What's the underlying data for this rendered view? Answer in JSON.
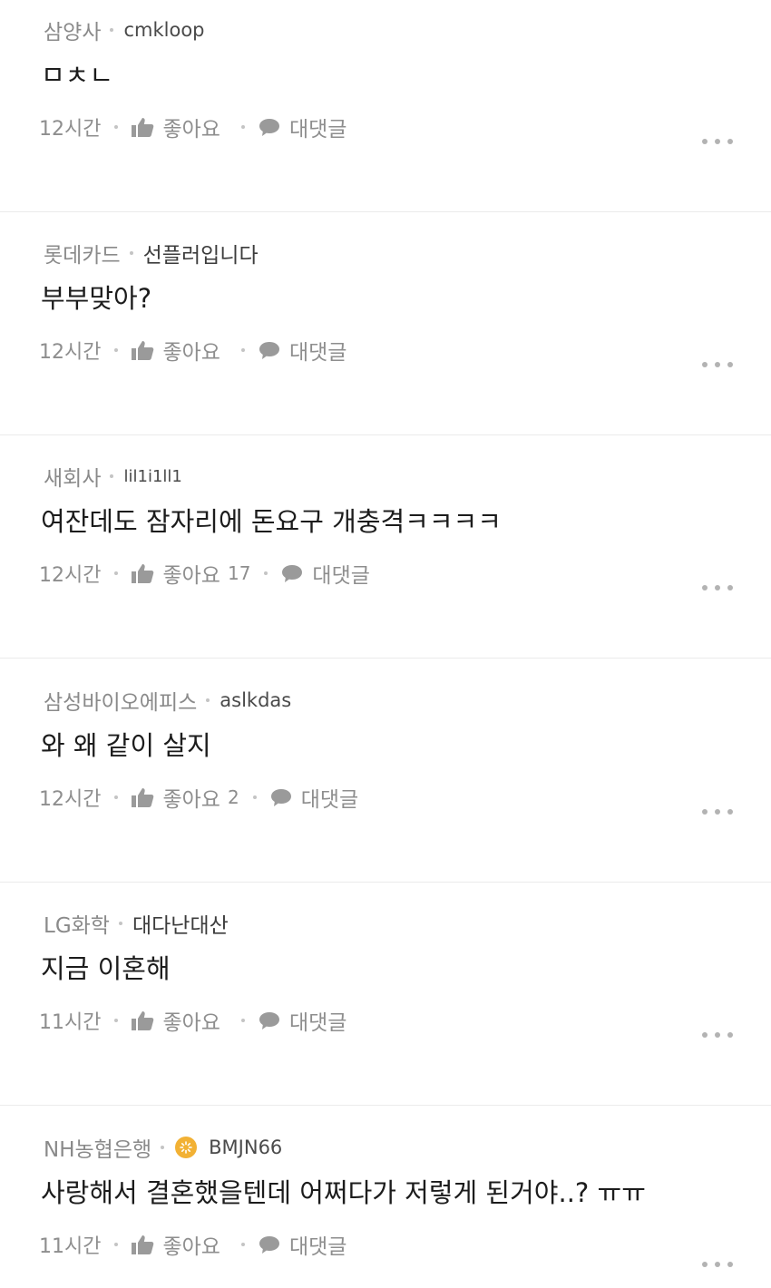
{
  "comments": [
    {
      "company": "삼양사",
      "nickname": "cmkloop",
      "content": "ㅁㅊㄴ",
      "time": "12시간",
      "like_label": "좋아요",
      "like_count": "",
      "reply_label": "대댓글"
    },
    {
      "company": "롯데카드",
      "nickname": "선플러입니다",
      "content": "부부맞아?",
      "time": "12시간",
      "like_label": "좋아요",
      "like_count": "",
      "reply_label": "대댓글"
    },
    {
      "company": "새회사",
      "nickname": "lil1i1ll1",
      "content": "여잔데도 잠자리에 돈요구 개충격ㅋㅋㅋㅋ",
      "time": "12시간",
      "like_label": "좋아요",
      "like_count": "17",
      "reply_label": "대댓글"
    },
    {
      "company": "삼성바이오에피스",
      "nickname": "aslkdas",
      "content": "와 왜 같이 살지",
      "time": "12시간",
      "like_label": "좋아요",
      "like_count": "2",
      "reply_label": "대댓글"
    },
    {
      "company": "LG화학",
      "nickname": "대다난대산",
      "content": "지금 이혼해",
      "time": "11시간",
      "like_label": "좋아요",
      "like_count": "",
      "reply_label": "대댓글"
    },
    {
      "company": "NH농협은행",
      "nickname": "BMJN66",
      "badge_icon": "sun-badge-icon",
      "content": "사랑해서 결혼했을텐데 어쩌다가 저렇게 된거야..? ㅠㅠ",
      "time": "11시간",
      "like_label": "좋아요",
      "like_count": "",
      "reply_label": "대댓글"
    }
  ],
  "icons": {
    "like": "thumbs-up-icon",
    "reply": "speech-bubble-icon",
    "more": "more-dots-icon"
  },
  "colors": {
    "text_primary": "#1c1c1c",
    "text_secondary": "#8e8e8e",
    "divider": "#ebebeb",
    "badge": "#f2b134"
  }
}
